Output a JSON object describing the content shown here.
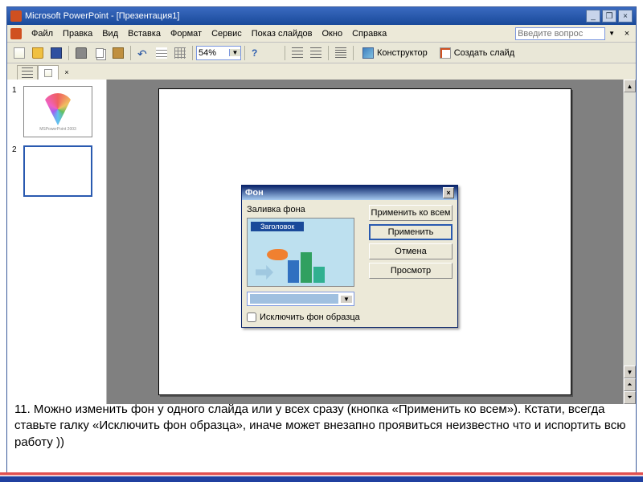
{
  "titlebar": {
    "title": "Microsoft PowerPoint - [Презентация1]"
  },
  "menu": {
    "file": "Файл",
    "edit": "Правка",
    "view": "Вид",
    "insert": "Вставка",
    "format": "Формат",
    "tools": "Сервис",
    "slideshow": "Показ слайдов",
    "window": "Окно",
    "help": "Справка",
    "ask_placeholder": "Введите вопрос"
  },
  "toolbar": {
    "zoom": "54%",
    "designer": "Конструктор",
    "new_slide": "Создать слайд"
  },
  "thumbs": {
    "n1": "1",
    "n2": "2",
    "cap1": "MSPowerPoint 2003"
  },
  "dialog": {
    "title": "Фон",
    "fill_label": "Заливка фона",
    "preview_title": "Заголовок",
    "btn_apply_all": "Применить ко всем",
    "btn_apply": "Применить",
    "btn_cancel": "Отмена",
    "btn_preview": "Просмотр",
    "exclude_master": "Исключить фон образца"
  },
  "note": "11.   Можно изменить фон у одного слайда или у всех сразу (кнопка «Применить ко всем»). Кстати, всегда ставьте галку «Исключить фон образца», иначе может внезапно проявиться неизвестно что и испортить всю работу ))"
}
